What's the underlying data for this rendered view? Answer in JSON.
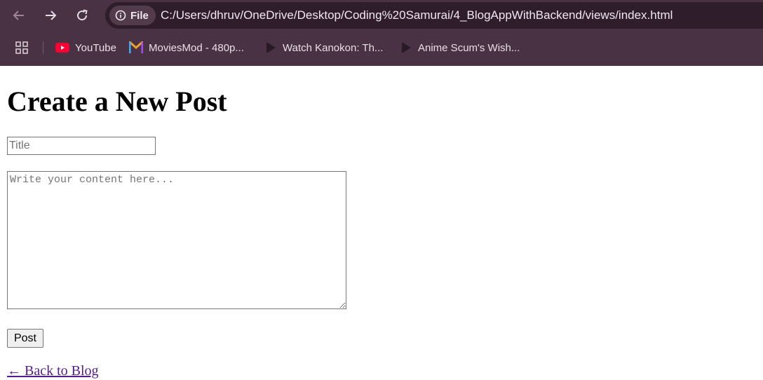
{
  "browser": {
    "nav": {
      "back_icon": "arrow-left-icon",
      "forward_icon": "arrow-right-icon",
      "reload_icon": "reload-icon"
    },
    "omnibox": {
      "chip_icon": "info-icon",
      "chip_label": "File",
      "url": "C:/Users/dhruv/OneDrive/Desktop/Coding%20Samurai/4_BlogAppWithBackend/views/index.html"
    },
    "bookmarks": [
      {
        "label": "YouTube",
        "icon": "youtube-icon"
      },
      {
        "label": "MoviesMod - 480p...",
        "icon": "moviesmod-icon"
      },
      {
        "label": "Watch Kanokon: Th...",
        "icon": "play-icon"
      },
      {
        "label": "Anime Scum's Wish...",
        "icon": "play-icon"
      }
    ],
    "colors": {
      "chrome": "#4a3245",
      "omnibox": "#2f1d2b",
      "youtube_red": "#ff0033"
    }
  },
  "page": {
    "heading": "Create a New Post",
    "title_placeholder": "Title",
    "title_value": "",
    "content_placeholder": "Write your content here...",
    "content_value": "",
    "post_button": "Post",
    "back_link": "← Back to Blog",
    "link_color": "#551a8b"
  }
}
